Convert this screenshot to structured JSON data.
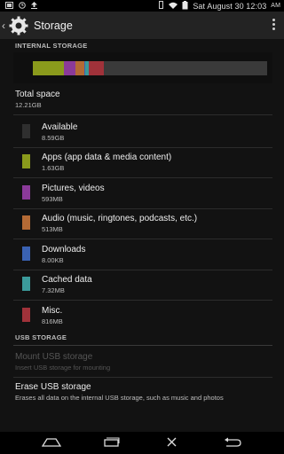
{
  "status": {
    "time": "Sat August 30 12:03",
    "ampm": "AM"
  },
  "header": {
    "title": "Storage"
  },
  "internal": {
    "label": "INTERNAL STORAGE",
    "total_label": "Total space",
    "total_value": "12.21GB",
    "items": [
      {
        "title": "Available",
        "size": "8.59GB",
        "color": "#2f2f2f"
      },
      {
        "title": "Apps (app data & media content)",
        "size": "1.63GB",
        "color": "#8a9a1c"
      },
      {
        "title": "Pictures, videos",
        "size": "593MB",
        "color": "#8b3a99"
      },
      {
        "title": "Audio (music, ringtones, podcasts, etc.)",
        "size": "513MB",
        "color": "#b46a35"
      },
      {
        "title": "Downloads",
        "size": "8.00KB",
        "color": "#3a62b3"
      },
      {
        "title": "Cached data",
        "size": "7.32MB",
        "color": "#3b9a9a"
      },
      {
        "title": "Misc.",
        "size": "816MB",
        "color": "#a0323a"
      }
    ]
  },
  "usb": {
    "label": "USB STORAGE",
    "mount_title": "Mount USB storage",
    "mount_sub": "Insert USB storage for mounting",
    "erase_title": "Erase USB storage",
    "erase_sub": "Erases all data on the internal USB storage, such as music and photos"
  },
  "storage_bar_fractions": {
    "apps": 0.133,
    "pictures": 0.047,
    "audio": 0.041,
    "downloads": 0.004,
    "cached": 0.012,
    "misc": 0.065
  }
}
